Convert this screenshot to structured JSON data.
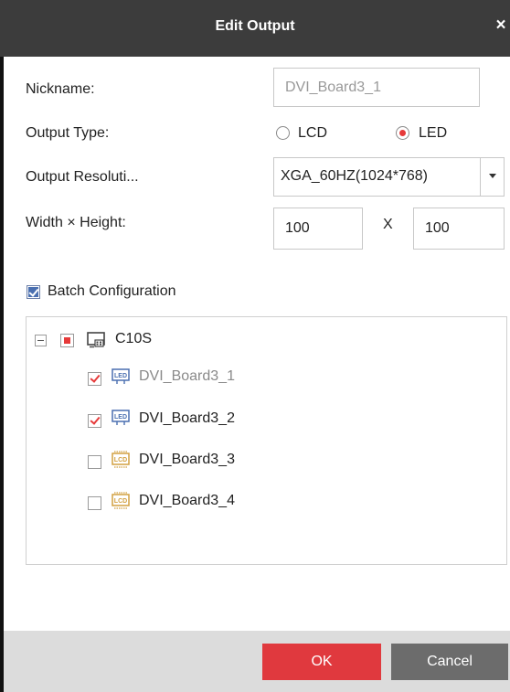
{
  "window": {
    "title": "Edit Output",
    "close_glyph": "×"
  },
  "form": {
    "nickname_label": "Nickname:",
    "nickname_value": "DVI_Board3_1",
    "output_type_label": "Output Type:",
    "output_type_options": [
      {
        "label": "LCD",
        "selected": false
      },
      {
        "label": "LED",
        "selected": true
      }
    ],
    "resolution_label": "Output Resoluti...",
    "resolution_value": "XGA_60HZ(1024*768)",
    "size_label": "Width × Height:",
    "width_value": "100",
    "size_separator": "X",
    "height_value": "100",
    "batch_label": "Batch Configuration",
    "batch_checked": true
  },
  "tree": {
    "root": {
      "label": "C10S",
      "icon": "display-monitor-icon",
      "state": "partial"
    },
    "children": [
      {
        "label": "DVI_Board3_1",
        "icon": "led-screen-icon",
        "checked": true,
        "disabled": true
      },
      {
        "label": "DVI_Board3_2",
        "icon": "led-screen-icon",
        "checked": true,
        "disabled": false
      },
      {
        "label": "DVI_Board3_3",
        "icon": "lcd-screen-icon",
        "checked": false,
        "disabled": false
      },
      {
        "label": "DVI_Board3_4",
        "icon": "lcd-screen-icon",
        "checked": false,
        "disabled": false
      }
    ]
  },
  "footer": {
    "ok_label": "OK",
    "cancel_label": "Cancel"
  },
  "colors": {
    "titlebar": "#3c3c3c",
    "accent_red": "#e0393e",
    "led_icon_blue": "#4a6fb0",
    "lcd_icon_gold": "#d2a040",
    "footer_bg": "#dcdcdc",
    "cancel_bg": "#6c6c6c"
  }
}
